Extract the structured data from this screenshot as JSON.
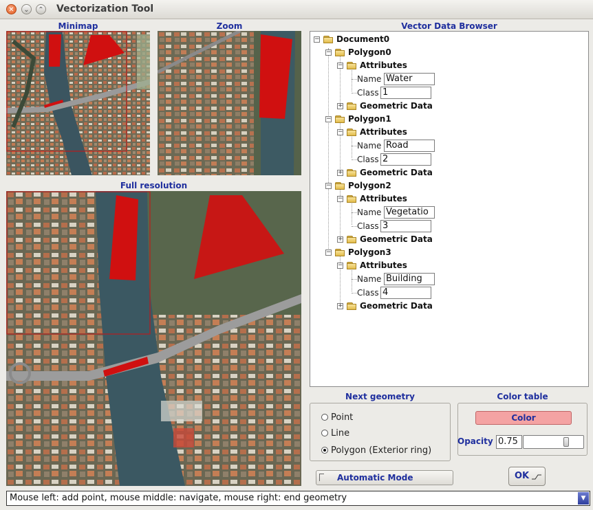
{
  "window": {
    "title": "Vectorization Tool"
  },
  "panels": {
    "minimap_label": "Minimap",
    "zoom_label": "Zoom",
    "full_label": "Full resolution",
    "browser_label": "Vector Data Browser"
  },
  "tree": {
    "root": "Document0",
    "attributes_label": "Attributes",
    "geometric_label": "Geometric Data",
    "name_label": "Name",
    "class_label": "Class",
    "polygons": [
      {
        "label": "Polygon0",
        "name": "Water",
        "class": "1"
      },
      {
        "label": "Polygon1",
        "name": "Road",
        "class": "2"
      },
      {
        "label": "Polygon2",
        "name": "Vegetatio",
        "class": "3"
      },
      {
        "label": "Polygon3",
        "name": "Building",
        "class": "4"
      }
    ]
  },
  "next_geometry": {
    "title": "Next geometry",
    "options": [
      "Point",
      "Line",
      "Polygon (Exterior ring)"
    ],
    "selected": "Polygon (Exterior ring)"
  },
  "color_table": {
    "title": "Color table",
    "color_label": "Color",
    "swatch_color": "#f4a3a3",
    "opacity_label": "Opacity",
    "opacity_value": "0.75"
  },
  "buttons": {
    "automatic_mode": "Automatic Mode",
    "ok": "OK"
  },
  "status": {
    "text": "Mouse left: add point, mouse middle: navigate, mouse right: end geometry"
  },
  "colors": {
    "label_blue": "#1f2f9e",
    "polygon_red": "#d01010"
  }
}
